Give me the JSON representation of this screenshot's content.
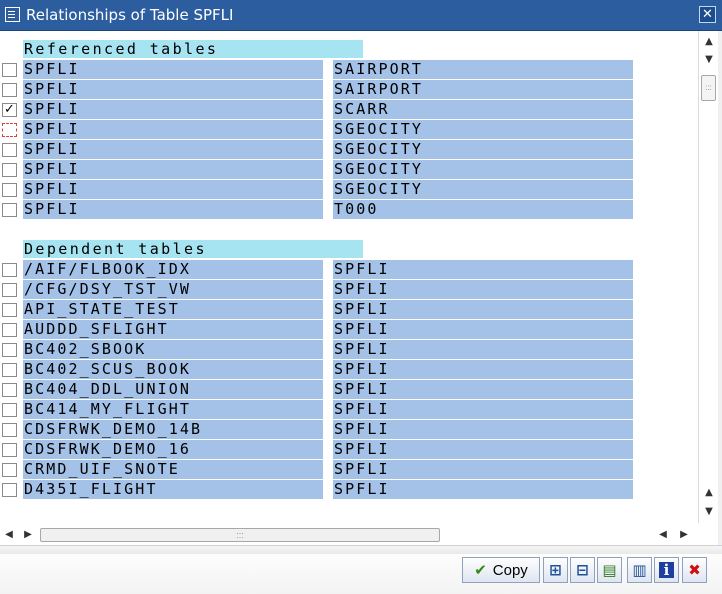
{
  "window": {
    "title": "Relationships of Table SPFLI",
    "close_glyph": "✕"
  },
  "referenced": {
    "header": "Referenced tables",
    "rows": [
      {
        "checked": "",
        "left": "SPFLI",
        "right": "SAIRPORT"
      },
      {
        "checked": "",
        "left": "SPFLI",
        "right": "SAIRPORT"
      },
      {
        "checked": "✓",
        "left": "SPFLI",
        "right": "SCARR"
      },
      {
        "checked": "",
        "left": "SPFLI",
        "right": "SGEOCITY"
      },
      {
        "checked": "",
        "left": "SPFLI",
        "right": "SGEOCITY"
      },
      {
        "checked": "",
        "left": "SPFLI",
        "right": "SGEOCITY"
      },
      {
        "checked": "",
        "left": "SPFLI",
        "right": "SGEOCITY"
      },
      {
        "checked": "",
        "left": "SPFLI",
        "right": "T000"
      }
    ]
  },
  "dependent": {
    "header": "Dependent tables",
    "rows": [
      {
        "checked": "",
        "left": "/AIF/FLBOOK_IDX",
        "right": "SPFLI"
      },
      {
        "checked": "",
        "left": "/CFG/DSY_TST_VW",
        "right": "SPFLI"
      },
      {
        "checked": "",
        "left": "API_STATE_TEST",
        "right": "SPFLI"
      },
      {
        "checked": "",
        "left": "AUDDD_SFLIGHT",
        "right": "SPFLI"
      },
      {
        "checked": "",
        "left": "BC402_SBOOK",
        "right": "SPFLI"
      },
      {
        "checked": "",
        "left": "BC402_SCUS_BOOK",
        "right": "SPFLI"
      },
      {
        "checked": "",
        "left": "BC404_DDL_UNION",
        "right": "SPFLI"
      },
      {
        "checked": "",
        "left": "BC414_MY_FLIGHT",
        "right": "SPFLI"
      },
      {
        "checked": "",
        "left": "CDSFRWK_DEMO_14B",
        "right": "SPFLI"
      },
      {
        "checked": "",
        "left": "CDSFRWK_DEMO_16",
        "right": "SPFLI"
      },
      {
        "checked": "",
        "left": "CRMD_UIF_SNOTE",
        "right": "SPFLI"
      },
      {
        "checked": "",
        "left": "D435I_FLIGHT",
        "right": "SPFLI"
      }
    ]
  },
  "scrollbars": {
    "up": "▲",
    "down": "▼",
    "left": "◀",
    "right": "▶",
    "grip": ":::"
  },
  "footer": {
    "copy_label": "Copy",
    "copy_check": "✔",
    "icons": [
      {
        "name": "insert-row-icon",
        "glyph": "⊞",
        "color": "#1f4f9a"
      },
      {
        "name": "delete-row-icon",
        "glyph": "⊟",
        "color": "#1f4f9a"
      },
      {
        "name": "select-all-icon",
        "glyph": "▤",
        "color": "#2f7a20"
      },
      {
        "name": "deselect-all-icon",
        "glyph": "▥",
        "color": "#1f4f9a"
      },
      {
        "name": "info-icon",
        "glyph": "i",
        "color": "#ffffff"
      },
      {
        "name": "cancel-icon",
        "glyph": "✖",
        "color": "#d01010"
      }
    ]
  }
}
